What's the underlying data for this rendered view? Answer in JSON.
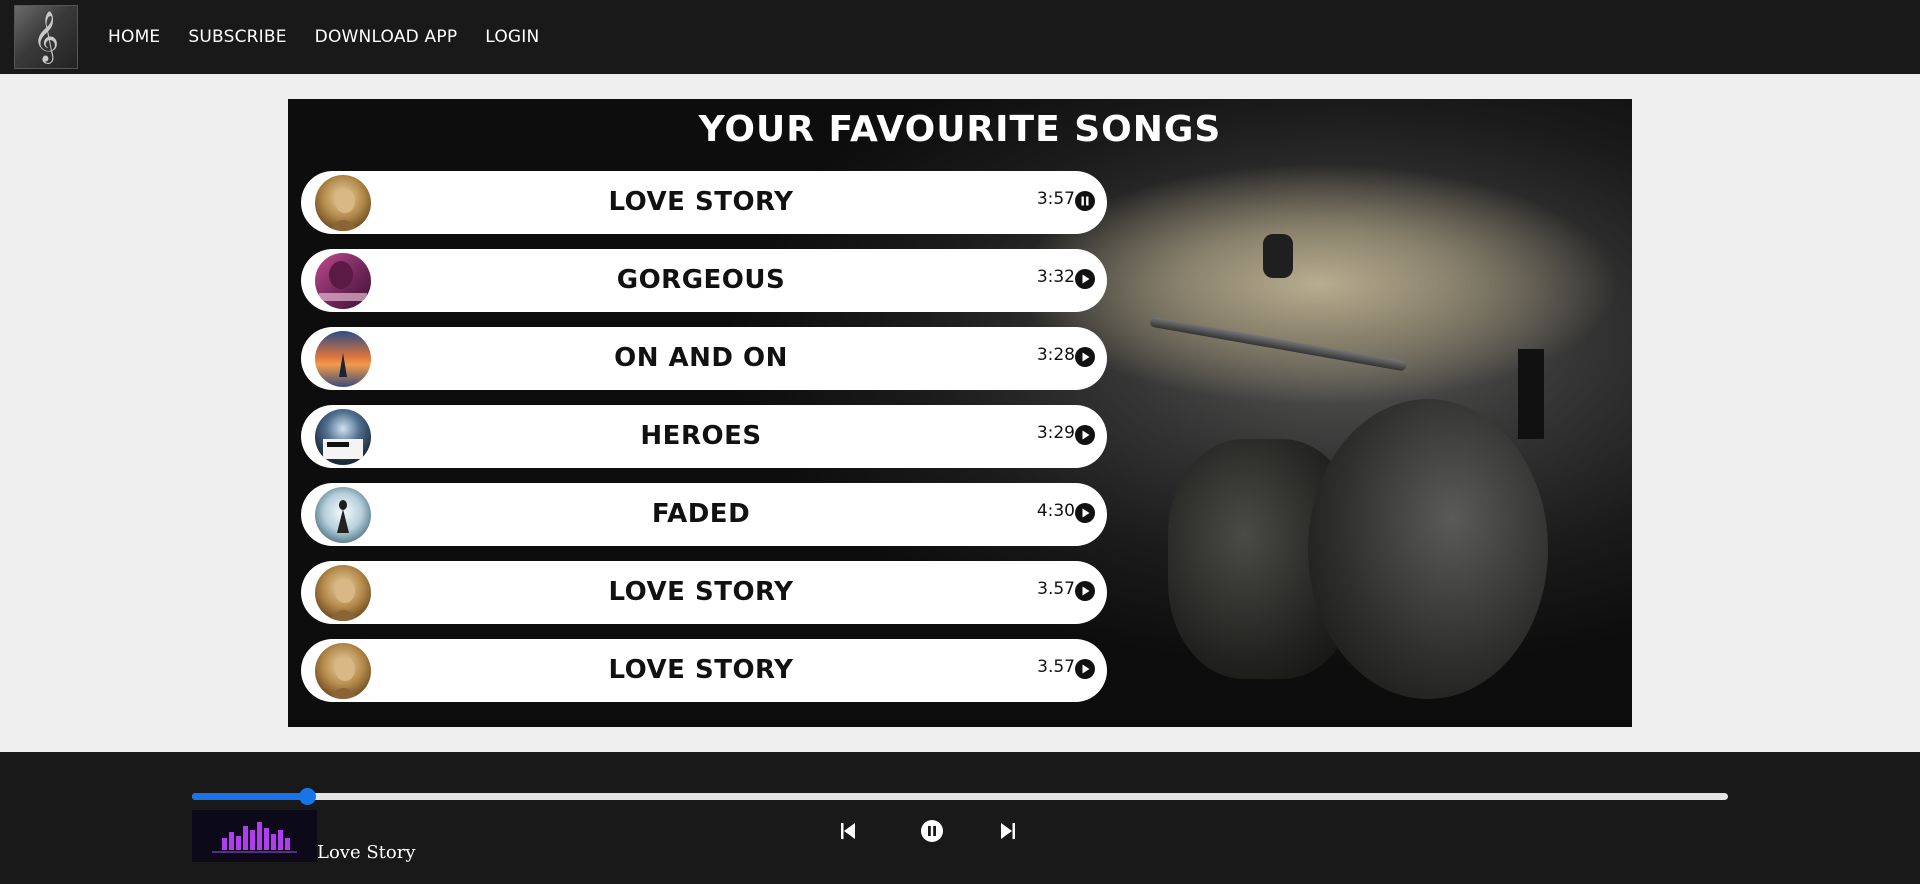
{
  "nav": {
    "logo_icon": "treble-clef-icon",
    "links": [
      "HOME",
      "SUBSCRIBE",
      "DOWNLOAD APP",
      "LOGIN"
    ]
  },
  "panel": {
    "title": "YOUR FAVOURITE SONGS",
    "songs": [
      {
        "title": "LOVE STORY",
        "duration": "3:57",
        "state_icon": "pause-circle-icon"
      },
      {
        "title": "GORGEOUS",
        "duration": "3:32",
        "state_icon": "play-circle-icon"
      },
      {
        "title": "ON AND ON",
        "duration": "3:28",
        "state_icon": "play-circle-icon"
      },
      {
        "title": "HEROES",
        "duration": "3:29",
        "state_icon": "play-circle-icon"
      },
      {
        "title": "FADED",
        "duration": "4:30",
        "state_icon": "play-circle-icon"
      },
      {
        "title": "LOVE STORY",
        "duration": "3.57",
        "state_icon": "play-circle-icon"
      },
      {
        "title": "LOVE STORY",
        "duration": "3.57",
        "state_icon": "play-circle-icon"
      }
    ]
  },
  "player": {
    "now_playing": "Love Story",
    "progress": 0.075,
    "accent": "#1a73e8",
    "controls": [
      "previous-icon",
      "pause-circle-icon",
      "next-icon"
    ]
  }
}
